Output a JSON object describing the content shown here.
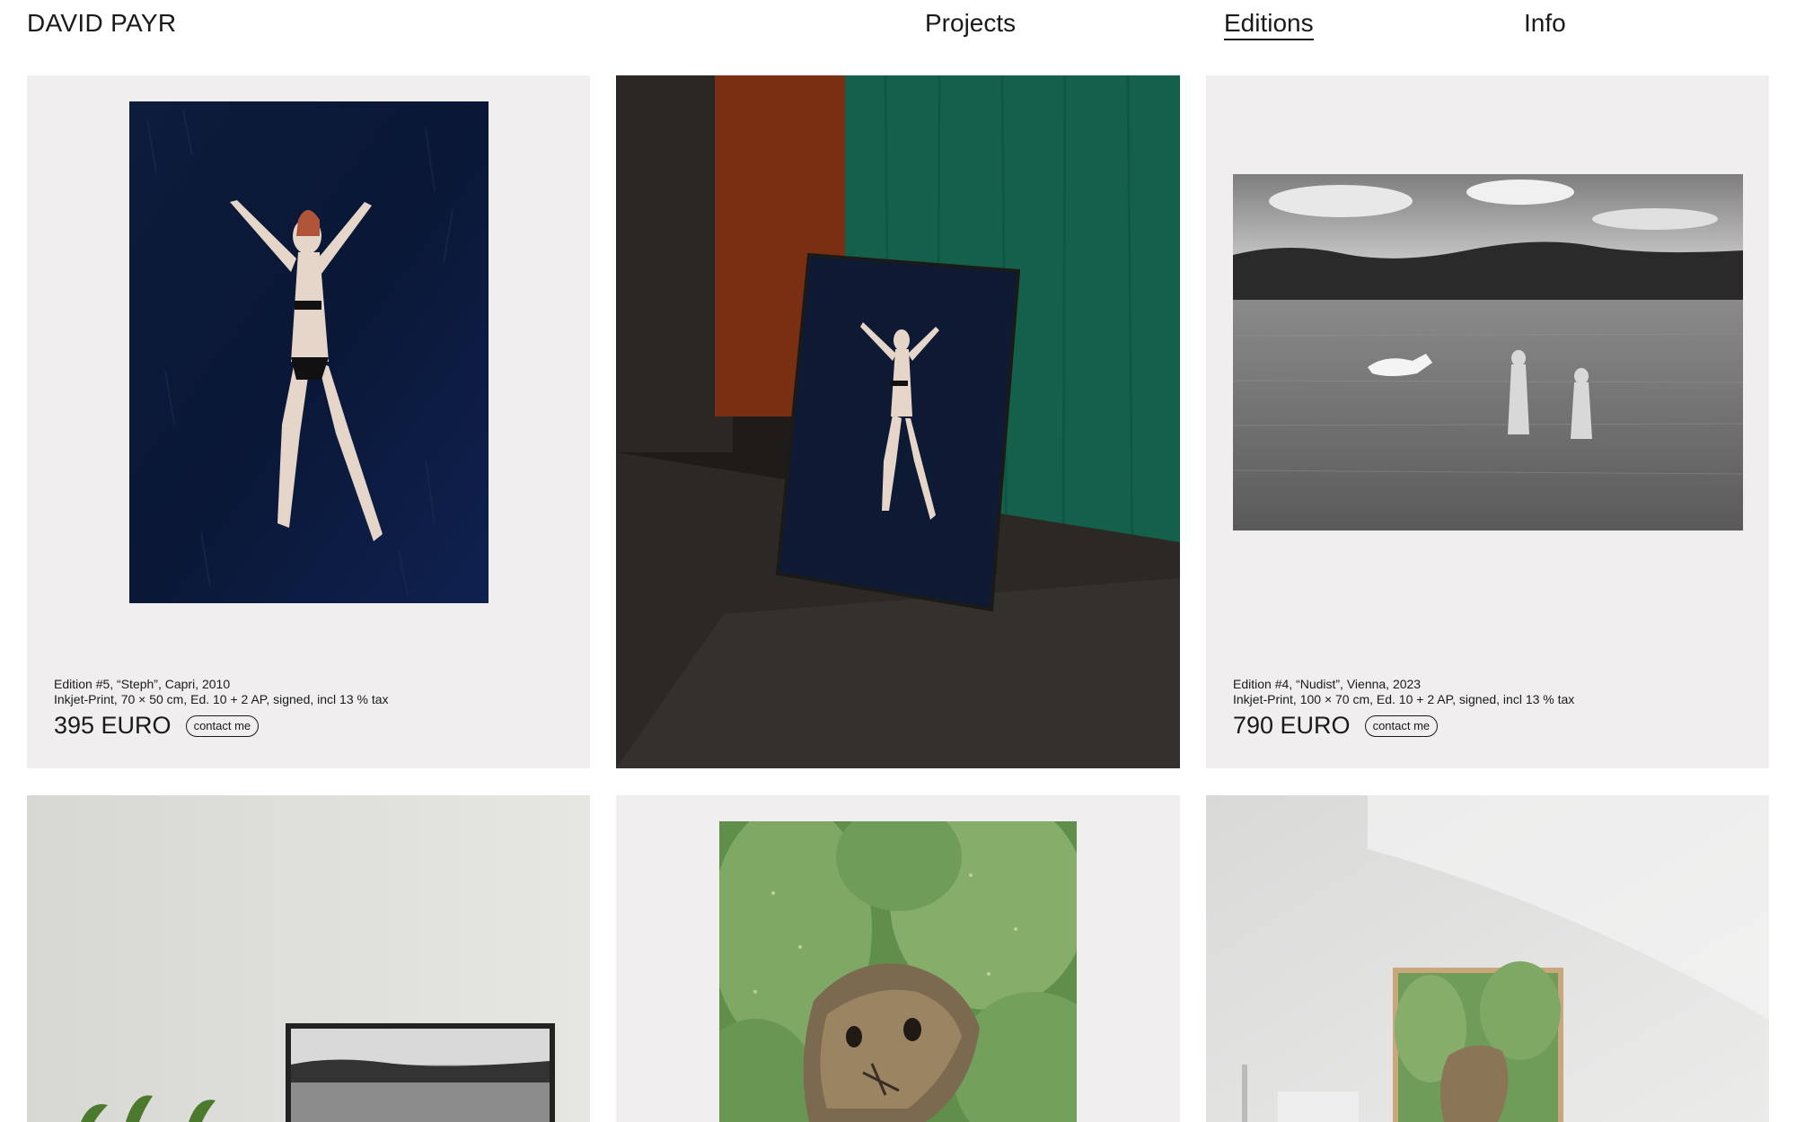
{
  "header": {
    "brand": "DAVID PAYR",
    "nav": {
      "projects": "Projects",
      "editions": "Editions",
      "info": "Info"
    }
  },
  "editions": [
    {
      "title": "Edition #5, “Steph”, Capri, 2010",
      "details": "Inkjet-Print, 70 × 50 cm, Ed. 10 + 2 AP, signed, incl 13 % tax",
      "price": "395 EURO",
      "contact_label": "contact me"
    },
    {
      "title": "Edition #4, “Nudist”, Vienna, 2023",
      "details": "Inkjet-Print, 100 × 70 cm, Ed. 10 + 2 AP, signed, incl 13 % tax",
      "price": "790 EURO",
      "contact_label": "contact me"
    }
  ],
  "colors": {
    "card_background": "#f0eeee",
    "text": "#1a1a1a"
  }
}
